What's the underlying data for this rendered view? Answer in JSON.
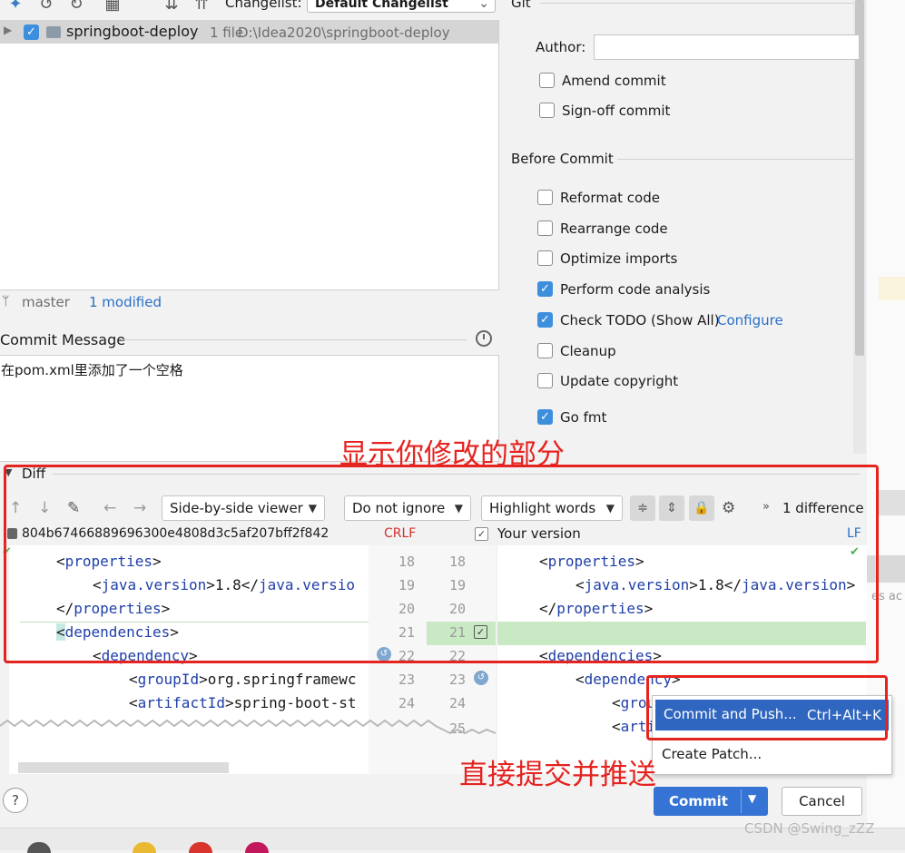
{
  "toolbar": {
    "changelist_label": "Changelist:",
    "changelist_value": "Default Changelist"
  },
  "tree": {
    "module_name": "springboot-deploy",
    "file_count": "1 file",
    "module_path": "D:\\Idea2020\\springboot-deploy"
  },
  "status": {
    "branch": "master",
    "modified": "1 modified"
  },
  "commit_message": {
    "label": "Commit Message",
    "text": "在pom.xml里添加了一个空格"
  },
  "git_options": {
    "section_title": "Git",
    "author_label": "Author:",
    "author_value": "",
    "amend_commit": "Amend commit",
    "sign_off_commit": "Sign-off commit"
  },
  "before_commit": {
    "title": "Before Commit",
    "options": [
      {
        "label": "Reformat code",
        "checked": false
      },
      {
        "label": "Rearrange code",
        "checked": false
      },
      {
        "label": "Optimize imports",
        "checked": false
      },
      {
        "label": "Perform code analysis",
        "checked": true
      },
      {
        "label": "Check TODO (Show All)",
        "checked": true
      },
      {
        "label": "Cleanup",
        "checked": false
      },
      {
        "label": "Update copyright",
        "checked": false
      },
      {
        "label": "Go fmt",
        "checked": true
      }
    ],
    "configure_link": "Configure"
  },
  "diff": {
    "title": "Diff",
    "viewer_mode": "Side-by-side viewer",
    "whitespace_mode": "Do not ignore",
    "highlight_mode": "Highlight words",
    "difference_count": "1 difference",
    "left_hash": "804b67466889696300e4808d3c5af207bff2f842",
    "left_line_ending": "CRLF",
    "right_title": "Your version",
    "right_line_ending": "LF",
    "left_line_numbers": [
      "18",
      "19",
      "20",
      "21",
      "22",
      "23",
      "24"
    ],
    "right_line_numbers": [
      "18",
      "19",
      "20",
      "21",
      "22",
      "23",
      "24",
      "25"
    ]
  },
  "annotations": {
    "diff_note": "显示你修改的部分",
    "push_note": "直接提交并推送"
  },
  "popup_menu": {
    "commit_and_push": "Commit and Push...",
    "commit_and_push_shortcut": "Ctrl+Alt+K",
    "create_patch": "Create Patch..."
  },
  "buttons": {
    "help": "?",
    "commit": "Commit",
    "cancel": "Cancel"
  },
  "right_edge_text": "es ac",
  "watermark": "CSDN @Swing_zZZ",
  "colors": {
    "accent_blue": "#3574d4",
    "annotation_red": "#e5231f",
    "diff_added_green": "#c9e9c4",
    "link_blue": "#2a6fc7"
  }
}
